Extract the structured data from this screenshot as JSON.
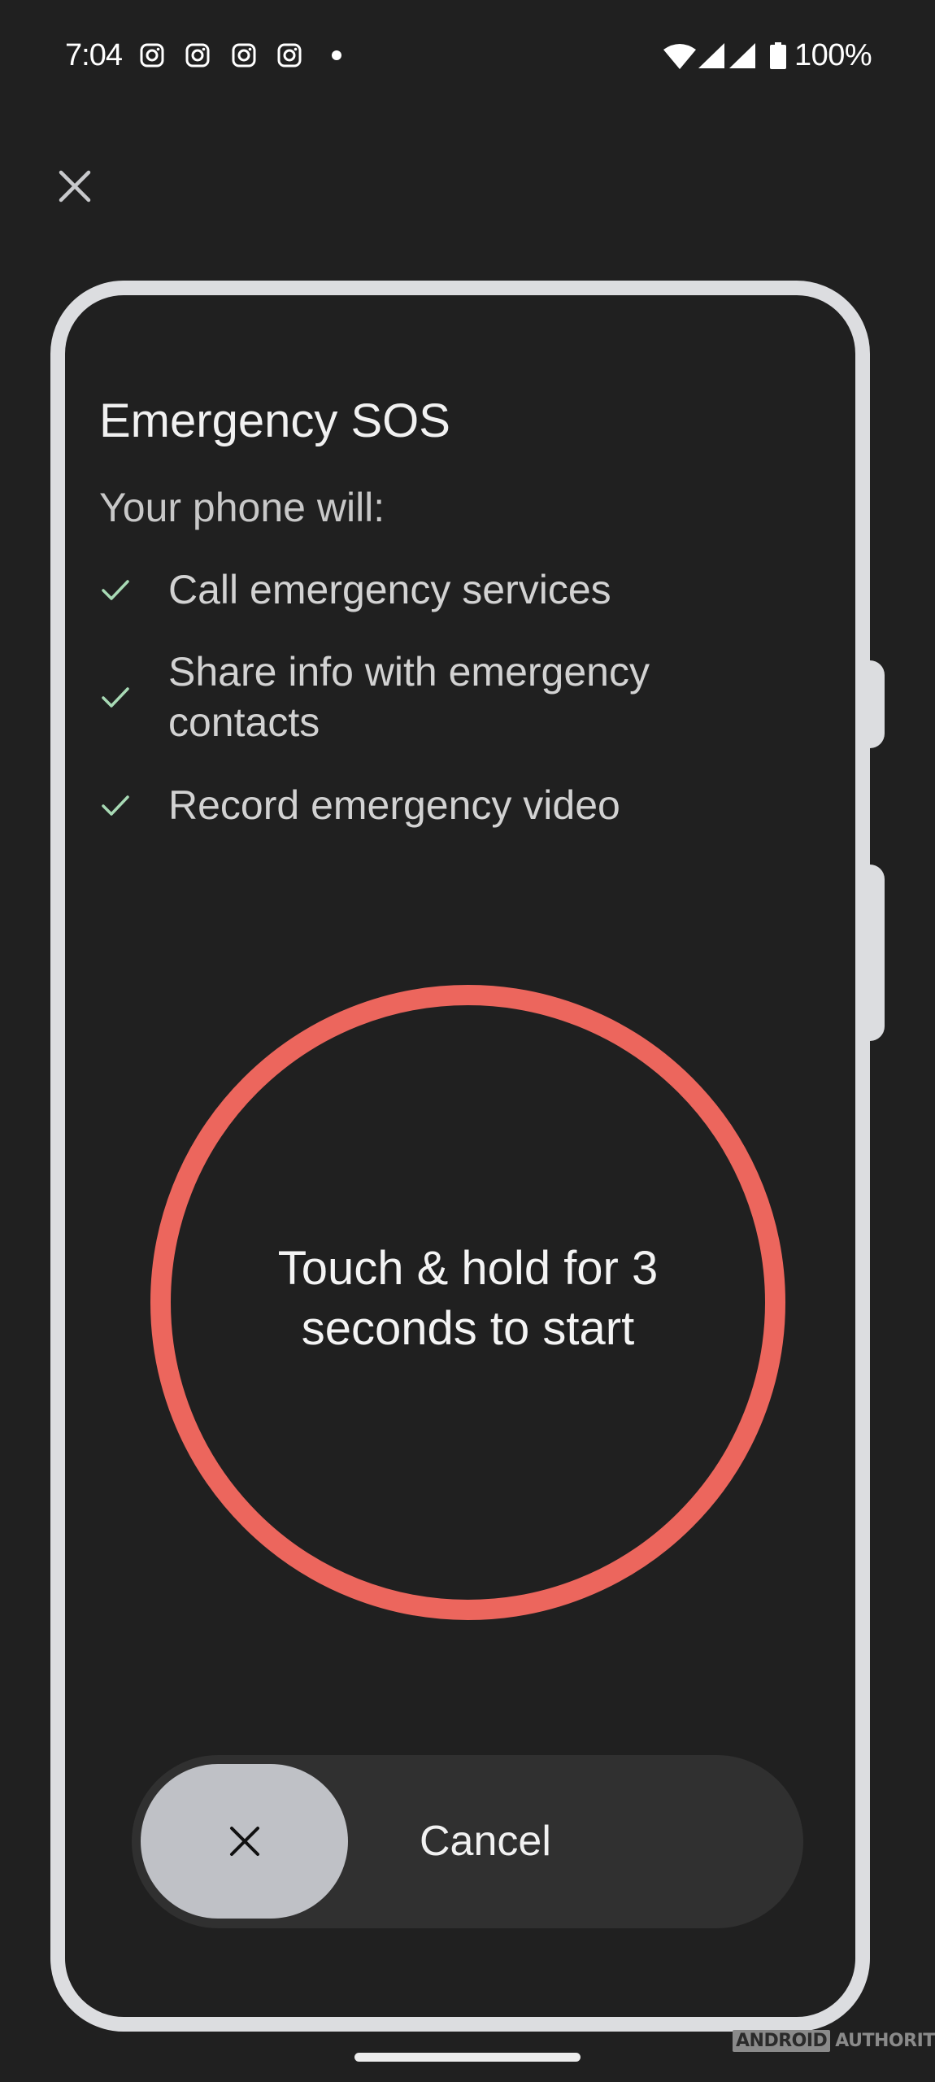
{
  "status_bar": {
    "time": "7:04",
    "notification_icons": [
      "instagram-icon",
      "instagram-icon",
      "instagram-icon",
      "instagram-icon"
    ],
    "more_notifications_indicator": "dot",
    "system_icons": [
      "wifi-icon",
      "signal-icon",
      "signal-icon",
      "battery-icon"
    ],
    "battery_percent": "100%"
  },
  "close_button": {
    "icon": "close-icon",
    "label": "Close"
  },
  "dialog": {
    "title": "Emergency SOS",
    "subtitle": "Your phone will:",
    "items": [
      {
        "icon": "check-icon",
        "text": "Call emergency services"
      },
      {
        "icon": "check-icon",
        "text": "Share info with emergency contacts"
      },
      {
        "icon": "check-icon",
        "text": "Record emergency video"
      }
    ]
  },
  "sos_button": {
    "label": "Touch & hold for 3 seconds to start",
    "ring_color": "#ec665d"
  },
  "cancel_slider": {
    "icon": "close-icon",
    "label": "Cancel"
  },
  "watermark": {
    "brand_boxed": "ANDROID",
    "brand_text": "AUTHORITY"
  },
  "colors": {
    "background": "#202020",
    "frame": "#dcdde0",
    "check": "#a8dab5",
    "accent_red": "#ec665d",
    "knob": "#bfc1c6",
    "pill": "#303030"
  }
}
